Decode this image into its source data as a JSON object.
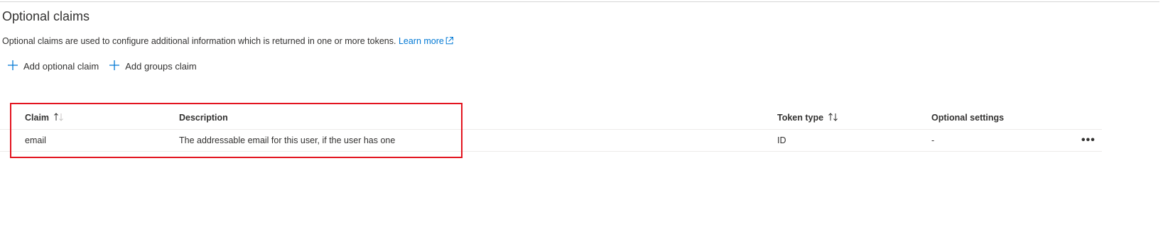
{
  "page": {
    "title": "Optional claims",
    "intro_text": "Optional claims are used to configure additional information which is returned in one or more tokens.",
    "learn_more": "Learn more"
  },
  "toolbar": {
    "add_optional_claim": "Add optional claim",
    "add_groups_claim": "Add groups claim"
  },
  "table": {
    "columns": [
      "Claim",
      "Description",
      "Token type",
      "Optional settings"
    ],
    "rows": [
      {
        "claim": "email",
        "description": "The addressable email for this user, if the user has one",
        "token_type": "ID",
        "optional_settings": "-"
      }
    ],
    "more_label": "•••"
  },
  "colors": {
    "link": "#0078d4",
    "highlight": "#e3141f",
    "text": "#323130"
  },
  "icons": {
    "external_link": "external-link-icon",
    "add": "plus-icon",
    "sort": "sort-icon",
    "more": "more-icon"
  }
}
